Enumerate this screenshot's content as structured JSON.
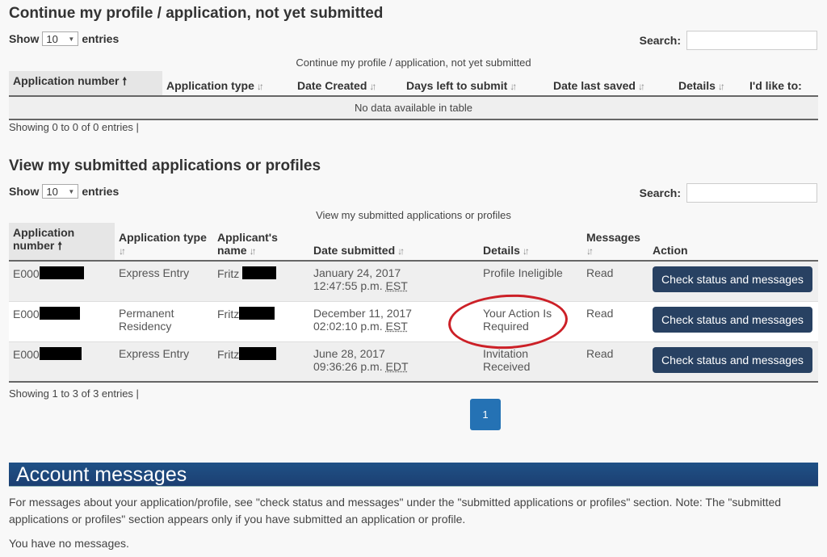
{
  "section1": {
    "title": "Continue my profile / application, not yet submitted",
    "show_label": "Show",
    "entries_label": "entries",
    "page_size": "10",
    "search_label": "Search:",
    "search_value": "",
    "caption": "Continue my profile / application, not yet submitted",
    "columns": [
      "Application number",
      "Application type",
      "Date Created",
      "Days left to submit",
      "Date last saved",
      "Details",
      "I'd like to:"
    ],
    "empty_text": "No data available in table",
    "info": "Showing 0 to 0 of 0 entries"
  },
  "section2": {
    "title": "View my submitted applications or profiles",
    "show_label": "Show",
    "entries_label": "entries",
    "page_size": "10",
    "search_label": "Search:",
    "search_value": "",
    "caption": "View my submitted applications or profiles",
    "columns": {
      "app_number_1": "Application",
      "app_number_2": "number",
      "app_type": "Application type",
      "name_1": "Applicant's",
      "name_2": "name",
      "date": "Date submitted",
      "details": "Details",
      "messages": "Messages",
      "action": "Action"
    },
    "rows": [
      {
        "app_number_prefix": "E000",
        "app_type": "Express Entry",
        "name": "Fritz",
        "date": "January 24, 2017",
        "time": "12:47:55 p.m.",
        "tz": "EST",
        "details": "Profile Ineligible",
        "messages": "Read",
        "action": "Check status and messages"
      },
      {
        "app_number_prefix": "E000",
        "app_type": "Permanent Residency",
        "name": "Fritz",
        "date": "December 11, 2017",
        "time": "02:02:10 p.m.",
        "tz": "EST",
        "details": "Your Action Is Required",
        "messages": "Read",
        "action": "Check status and messages"
      },
      {
        "app_number_prefix": "E000",
        "app_type": "Express Entry",
        "name": "Fritz",
        "date": "June 28, 2017",
        "time": "09:36:26 p.m.",
        "tz": "EDT",
        "details": "Invitation Received",
        "messages": "Read",
        "action": "Check status and messages"
      }
    ],
    "info": "Showing 1 to 3 of 3 entries",
    "current_page": "1"
  },
  "account_messages": {
    "title": "Account messages",
    "note": "For messages about your application/profile, see \"check status and messages\" under the \"submitted applications or profiles\" section. Note: The \"submitted applications or profiles\" section appears only if you have submitted an application or profile.",
    "empty": "You have no messages."
  },
  "colors": {
    "button": "#284162",
    "pager": "#2572b4",
    "banner": "#1f4a7e",
    "annotation": "#cc2027"
  }
}
